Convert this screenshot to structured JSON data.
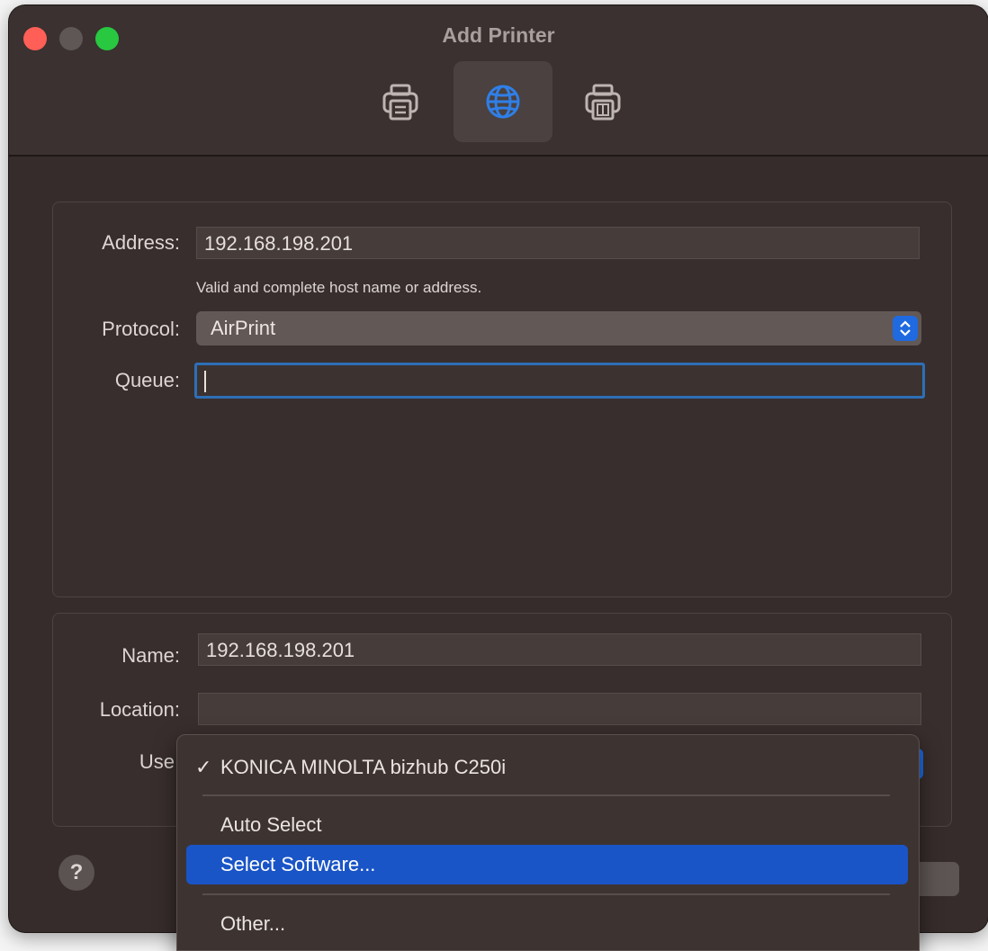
{
  "window": {
    "title": "Add Printer"
  },
  "toolbar": {
    "items": [
      {
        "icon": "printer-icon",
        "active": false
      },
      {
        "icon": "globe-icon",
        "active": true
      },
      {
        "icon": "windows-printer-icon",
        "active": false
      }
    ]
  },
  "connection": {
    "address_label": "Address:",
    "address_value": "192.168.198.201",
    "address_hint": "Valid and complete host name or address.",
    "protocol_label": "Protocol:",
    "protocol_value": "AirPrint",
    "queue_label": "Queue:",
    "queue_value": ""
  },
  "details": {
    "name_label": "Name:",
    "name_value": "192.168.198.201",
    "location_label": "Location:",
    "location_value": "",
    "use_label": "Use"
  },
  "use_menu": {
    "items": [
      {
        "label": "KONICA MINOLTA bizhub C250i",
        "checked": true
      },
      {
        "label": "Auto Select"
      },
      {
        "label": "Select Software...",
        "highlighted": true
      },
      {
        "label": "Other..."
      }
    ]
  },
  "footer": {
    "help_label": "?"
  },
  "colors": {
    "accent": "#1a55c7",
    "window_bg": "#362c2b"
  }
}
